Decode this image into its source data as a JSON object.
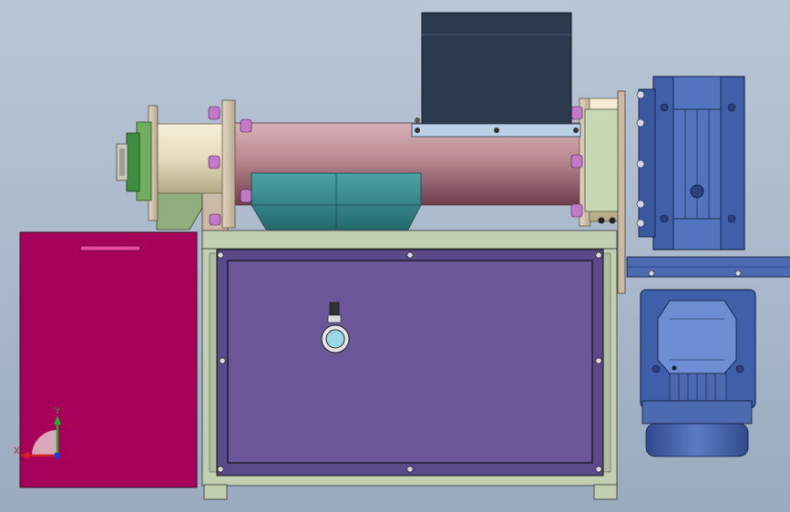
{
  "viewport": {
    "background_top": "#b9c6d6",
    "background_bottom": "#9aabc0"
  },
  "triad": {
    "x_label": "X",
    "y_label": "Y",
    "x_color": "#d42020",
    "y_color": "#22b022",
    "z_color": "#2040d0"
  },
  "colors": {
    "hopper": "#2b3a4d",
    "barrel": "#b98a93",
    "motor": "#3f5fa8",
    "collector": "#2f7f86",
    "tank": "#6b569a",
    "frame": "#c2cfb0",
    "bin": "#a6005a",
    "bolt": "#c27ac7"
  }
}
